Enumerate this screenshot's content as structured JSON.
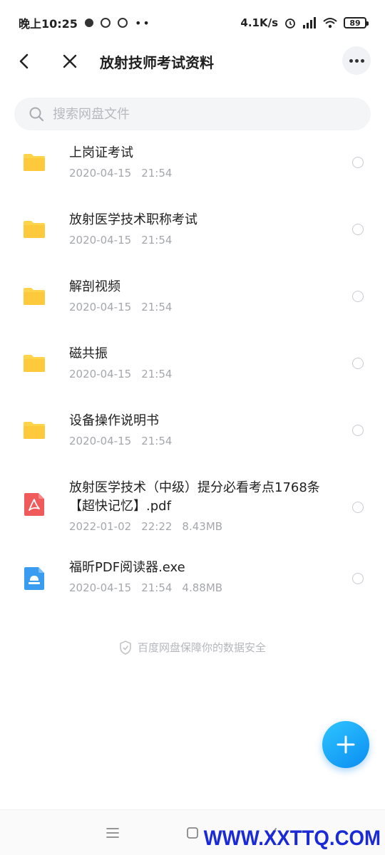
{
  "status_bar": {
    "time": "晚上10:25",
    "dots": "••",
    "net_speed": "4.1K/s",
    "battery": "89"
  },
  "header": {
    "title": "放射技师考试资料"
  },
  "search": {
    "placeholder": "搜索网盘文件"
  },
  "files": [
    {
      "name": "上岗证考试",
      "date": "2020-04-15",
      "time": "21:54",
      "size": "",
      "type": "folder"
    },
    {
      "name": "放射医学技术职称考试",
      "date": "2020-04-15",
      "time": "21:54",
      "size": "",
      "type": "folder"
    },
    {
      "name": "解剖视频",
      "date": "2020-04-15",
      "time": "21:54",
      "size": "",
      "type": "folder"
    },
    {
      "name": "磁共振",
      "date": "2020-04-15",
      "time": "21:54",
      "size": "",
      "type": "folder"
    },
    {
      "name": "设备操作说明书",
      "date": "2020-04-15",
      "time": "21:54",
      "size": "",
      "type": "folder"
    },
    {
      "name": "放射医学技术（中级）提分必看考点1768条【超快记忆】.pdf",
      "date": "2022-01-02",
      "time": "22:22",
      "size": "8.43MB",
      "type": "pdf"
    },
    {
      "name": "福昕PDF阅读器.exe",
      "date": "2020-04-15",
      "time": "21:54",
      "size": "4.88MB",
      "type": "exe"
    }
  ],
  "footer": {
    "safety_note": "百度网盘保障你的数据安全"
  },
  "watermark": "WWW.XXTTQ.COM",
  "colors": {
    "folder": "#fdd44a",
    "pdf": "#f05a5a",
    "exe": "#3a9cf0",
    "fab": "#1aa8f7"
  },
  "icons": {
    "back": "chevron-left-icon",
    "close": "close-icon",
    "more": "more-dots-icon",
    "search": "search-icon",
    "fab": "plus-icon",
    "shield": "shield-icon"
  }
}
